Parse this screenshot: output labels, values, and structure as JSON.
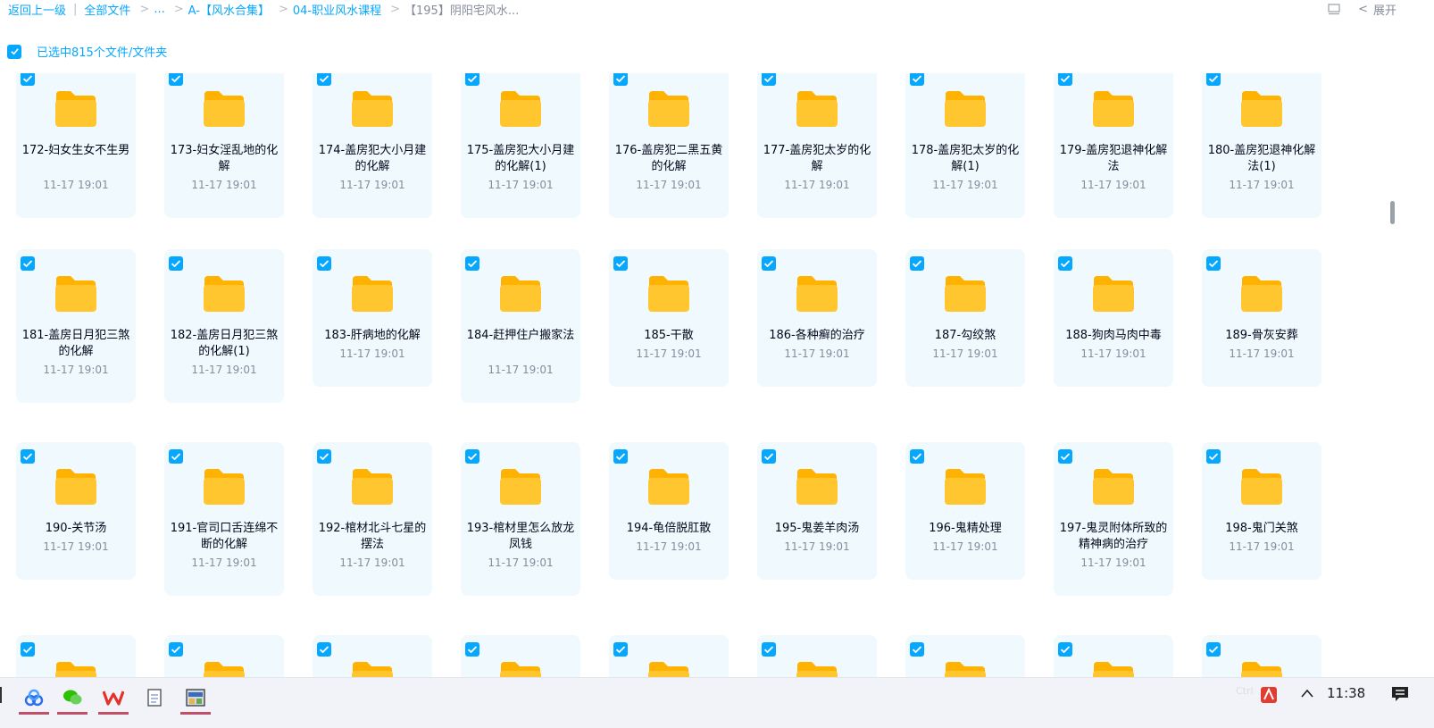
{
  "breadcrumb": {
    "back": "返回上一级",
    "all_files": "全部文件",
    "ellipsis": "...",
    "items": [
      "A-【风水合集】",
      "04-职业风水课程",
      "【195】阴阳宅风水..."
    ]
  },
  "toolbar": {
    "expand_label": "展开"
  },
  "selection": {
    "text": "已选中815个文件/文件夹"
  },
  "colors": {
    "accent": "#06a7ff",
    "card_bg": "#eff9fe",
    "folder": "#ffc630"
  },
  "rows": [
    [
      {
        "name": "172-妇女生女不生男",
        "date": "11-17 19:01"
      },
      {
        "name": "173-妇女淫乱地的化解",
        "date": "11-17 19:01"
      },
      {
        "name": "174-盖房犯大小月建的化解",
        "date": "11-17 19:01"
      },
      {
        "name": "175-盖房犯大小月建的化解(1)",
        "date": "11-17 19:01"
      },
      {
        "name": "176-盖房犯二黑五黄的化解",
        "date": "11-17 19:01"
      },
      {
        "name": "177-盖房犯太岁的化解",
        "date": "11-17 19:01"
      },
      {
        "name": "178-盖房犯太岁的化解(1)",
        "date": "11-17 19:01"
      },
      {
        "name": "179-盖房犯退神化解法",
        "date": "11-17 19:01"
      },
      {
        "name": "180-盖房犯退神化解法(1)",
        "date": "11-17 19:01"
      }
    ],
    [
      {
        "name": "181-盖房日月犯三煞的化解",
        "date": "11-17 19:01"
      },
      {
        "name": "182-盖房日月犯三煞的化解(1)",
        "date": "11-17 19:01"
      },
      {
        "name": "183-肝病地的化解",
        "date": "11-17 19:01"
      },
      {
        "name": "184-赶押住户搬家法",
        "date": "11-17 19:01"
      },
      {
        "name": "185-干散",
        "date": "11-17 19:01"
      },
      {
        "name": "186-各种癣的治疗",
        "date": "11-17 19:01"
      },
      {
        "name": "187-勾绞煞",
        "date": "11-17 19:01"
      },
      {
        "name": "188-狗肉马肉中毒",
        "date": "11-17 19:01"
      },
      {
        "name": "189-骨灰安葬",
        "date": "11-17 19:01"
      }
    ],
    [
      {
        "name": "190-关节汤",
        "date": "11-17 19:01"
      },
      {
        "name": "191-官司口舌连绵不断的化解",
        "date": "11-17 19:01"
      },
      {
        "name": "192-棺材北斗七星的摆法",
        "date": "11-17 19:01"
      },
      {
        "name": "193-棺材里怎么放龙凤钱",
        "date": "11-17 19:01"
      },
      {
        "name": "194-龟倍脱肛散",
        "date": "11-17 19:01"
      },
      {
        "name": "195-鬼姜羊肉汤",
        "date": "11-17 19:01"
      },
      {
        "name": "196-鬼精处理",
        "date": "11-17 19:01"
      },
      {
        "name": "197-鬼灵附体所致的精神病的治疗",
        "date": "11-17 19:01"
      },
      {
        "name": "198-鬼门关煞",
        "date": "11-17 19:01"
      }
    ]
  ],
  "taskbar": {
    "clock": "11:38",
    "ime": "Ctrl"
  }
}
